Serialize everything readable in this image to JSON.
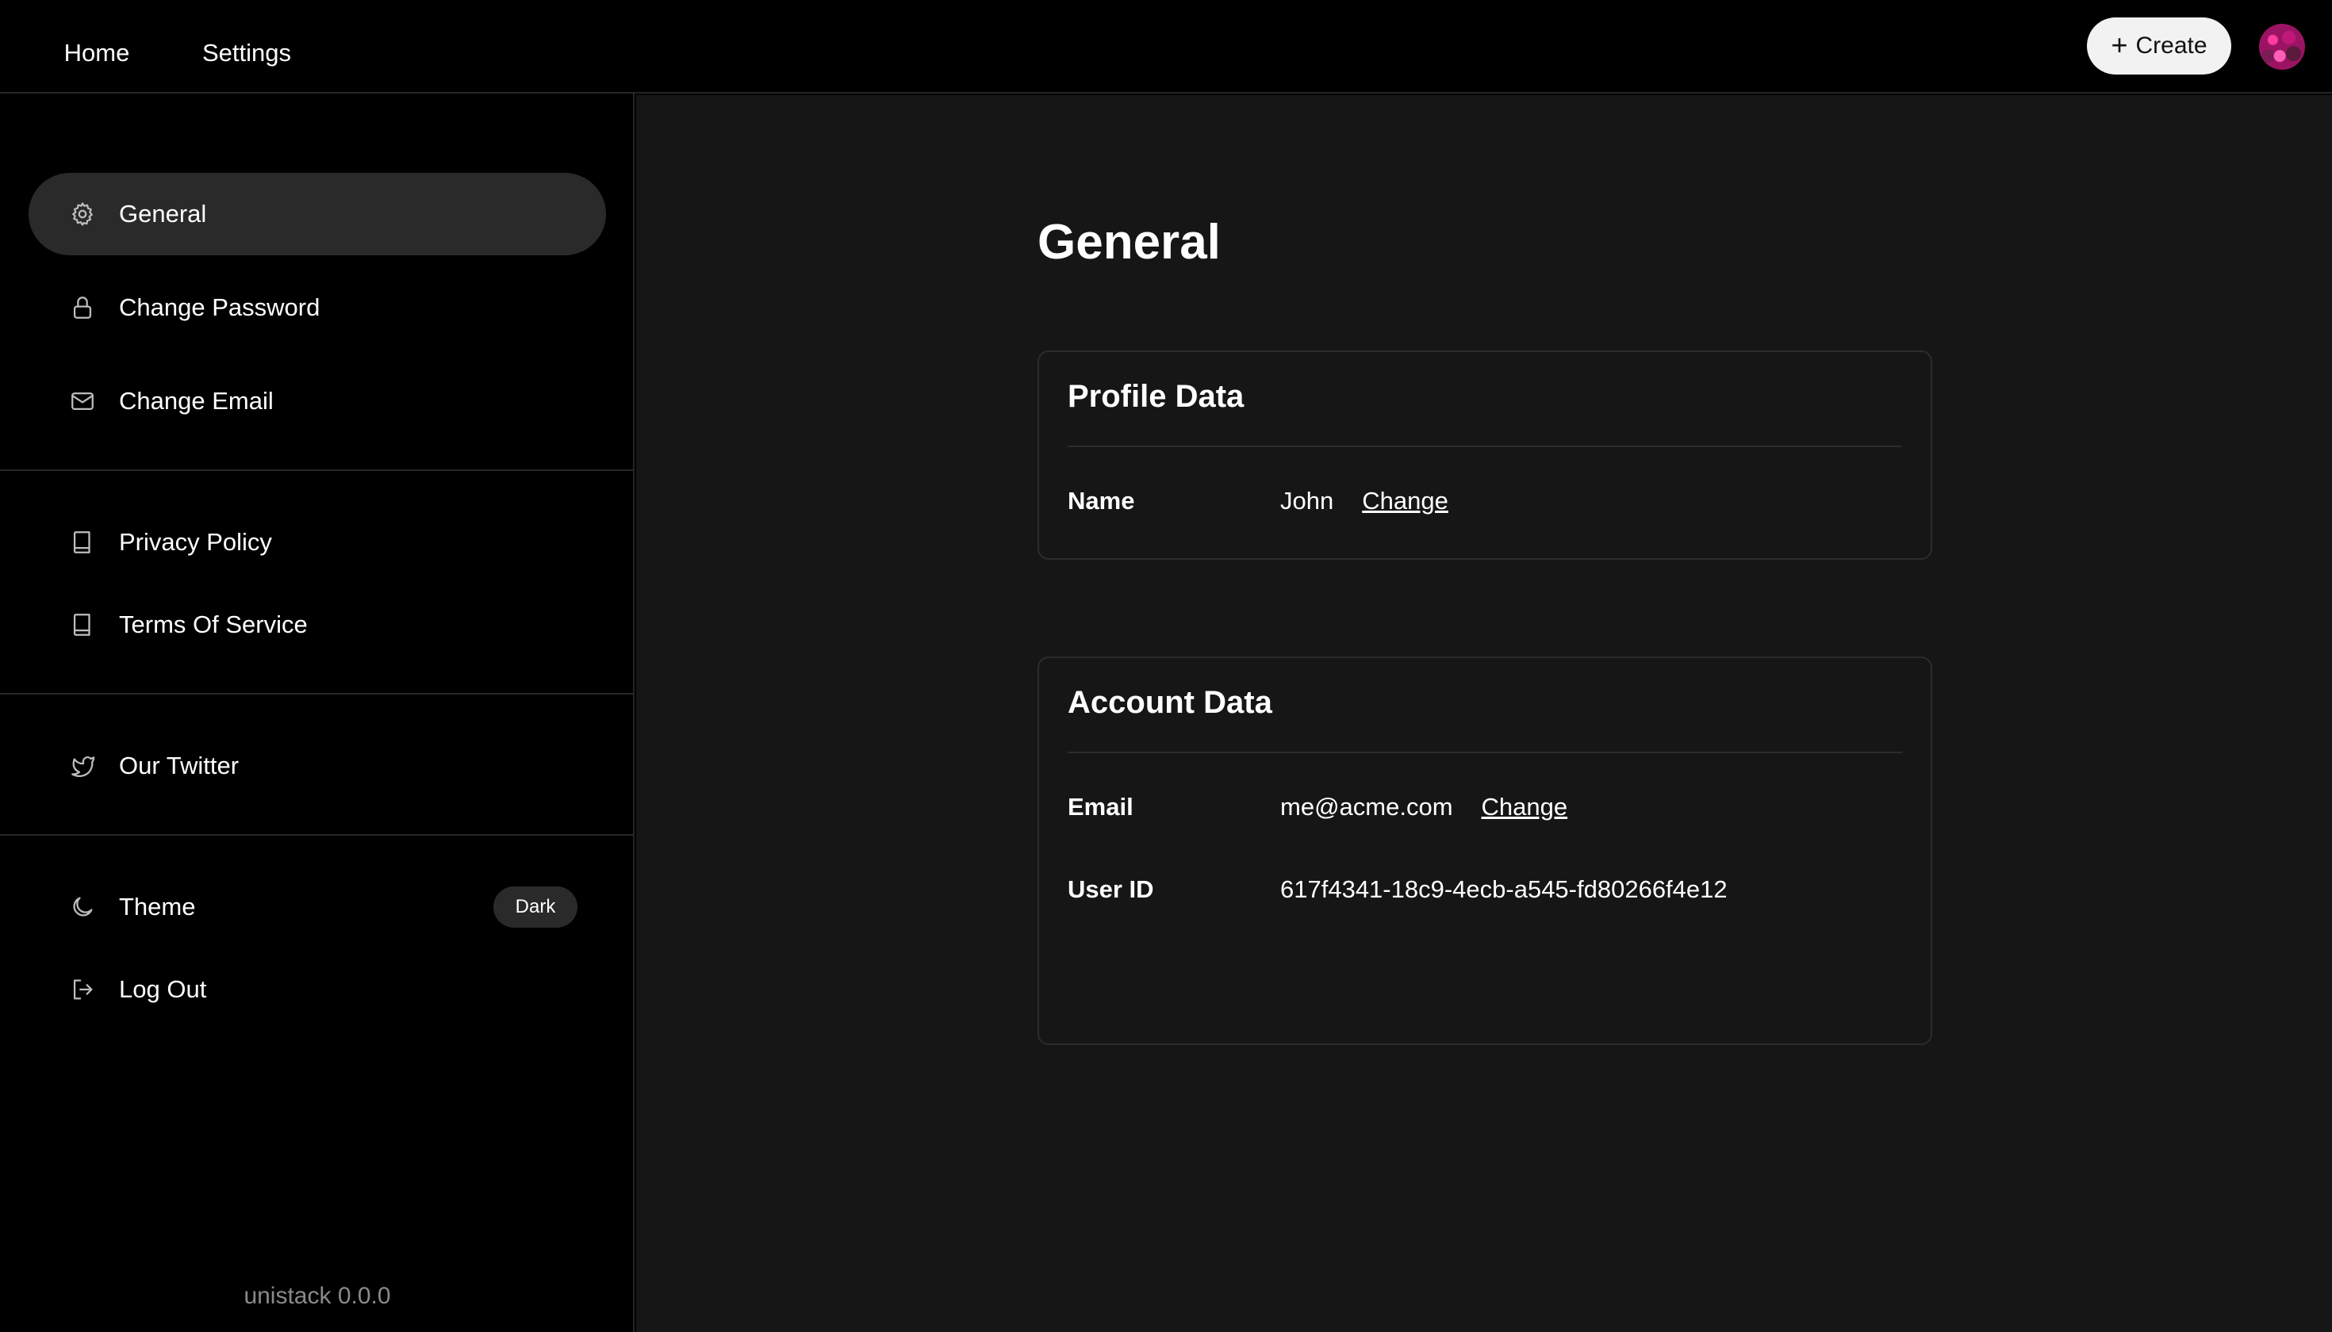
{
  "topbar": {
    "tabs": [
      {
        "label": "Home"
      },
      {
        "label": "Settings",
        "active": true
      }
    ],
    "create_label": "Create",
    "create_icon": "plus-icon"
  },
  "sidebar": {
    "items": [
      {
        "label": "General",
        "icon": "gear-icon",
        "active": true
      },
      {
        "label": "Change Password",
        "icon": "lock-icon"
      },
      {
        "label": "Change Email",
        "icon": "mail-icon"
      },
      {
        "label": "Privacy Policy",
        "icon": "book-icon"
      },
      {
        "label": "Terms Of Service",
        "icon": "book-icon"
      },
      {
        "label": "Our Twitter",
        "icon": "twitter-icon"
      },
      {
        "label": "Theme",
        "icon": "moon-icon",
        "badge": "Dark"
      },
      {
        "label": "Log Out",
        "icon": "logout-icon"
      }
    ],
    "version": "unistack 0.0.0"
  },
  "main": {
    "title": "General",
    "profile": {
      "title": "Profile Data",
      "name_label": "Name",
      "name_value": "John",
      "change_label": "Change"
    },
    "account": {
      "title": "Account Data",
      "email_label": "Email",
      "email_value": "me@acme.com",
      "change_label": "Change",
      "userid_label": "User ID",
      "userid_value": "617f4341-18c9-4ecb-a545-fd80266f4e12"
    }
  },
  "colors": {
    "background": "#000000",
    "main_background": "#161616",
    "active_item": "#2a2a2a",
    "border": "#262626",
    "text": "#ffffff",
    "muted_text": "#8a8a8a"
  }
}
